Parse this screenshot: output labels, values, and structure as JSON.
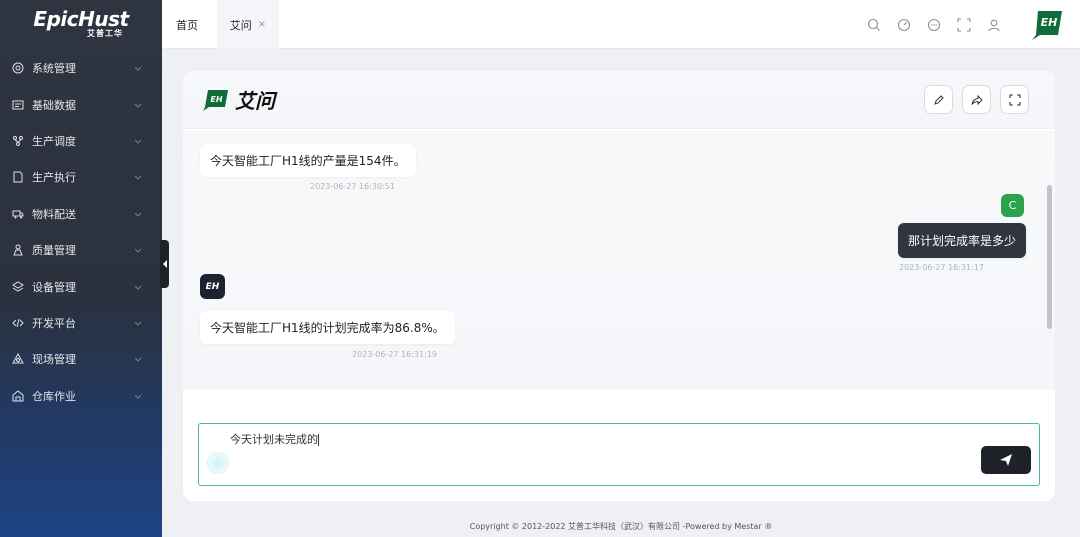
{
  "logo": {
    "main": "EpicHust",
    "sub": "艾普工华"
  },
  "sidebar": {
    "items": [
      {
        "label": "系统管理",
        "icon": "settings-circle-icon"
      },
      {
        "label": "基础数据",
        "icon": "data-table-icon"
      },
      {
        "label": "生产调度",
        "icon": "schedule-flow-icon"
      },
      {
        "label": "生产执行",
        "icon": "document-icon"
      },
      {
        "label": "物料配送",
        "icon": "truck-icon"
      },
      {
        "label": "质量管理",
        "icon": "quality-flask-icon"
      },
      {
        "label": "设备管理",
        "icon": "layers-icon"
      },
      {
        "label": "开发平台",
        "icon": "code-icon"
      },
      {
        "label": "现场管理",
        "icon": "triangle-icon"
      },
      {
        "label": "仓库作业",
        "icon": "warehouse-icon"
      }
    ]
  },
  "tabs": {
    "home": "首页",
    "aiwen": "艾问",
    "close": "×"
  },
  "card": {
    "title": "艾问",
    "badge": "EH"
  },
  "chat": {
    "m1_text": "今天智能工厂H1线的产量是154件。",
    "m1_time": "2023-06-27 16:30:51",
    "user_avatar": "C",
    "m2_text": "那计划完成率是多少",
    "m2_time": "2023-06-27 16:31:17",
    "bot_avatar": "EH",
    "m3_text": "今天智能工厂H1线的计划完成率为86.8%。",
    "m3_time": "2023-06-27 16:31:19"
  },
  "input": {
    "value": "今天计划未完成的"
  },
  "footer": {
    "text": "Copyright © 2012-2022 艾普工华科技（武汉）有限公司 -Powered by Mestar ®"
  },
  "colors": {
    "accent_green": "#2ba24c",
    "sidebar_dark": "#2e3440",
    "input_border": "#49b8a6"
  }
}
